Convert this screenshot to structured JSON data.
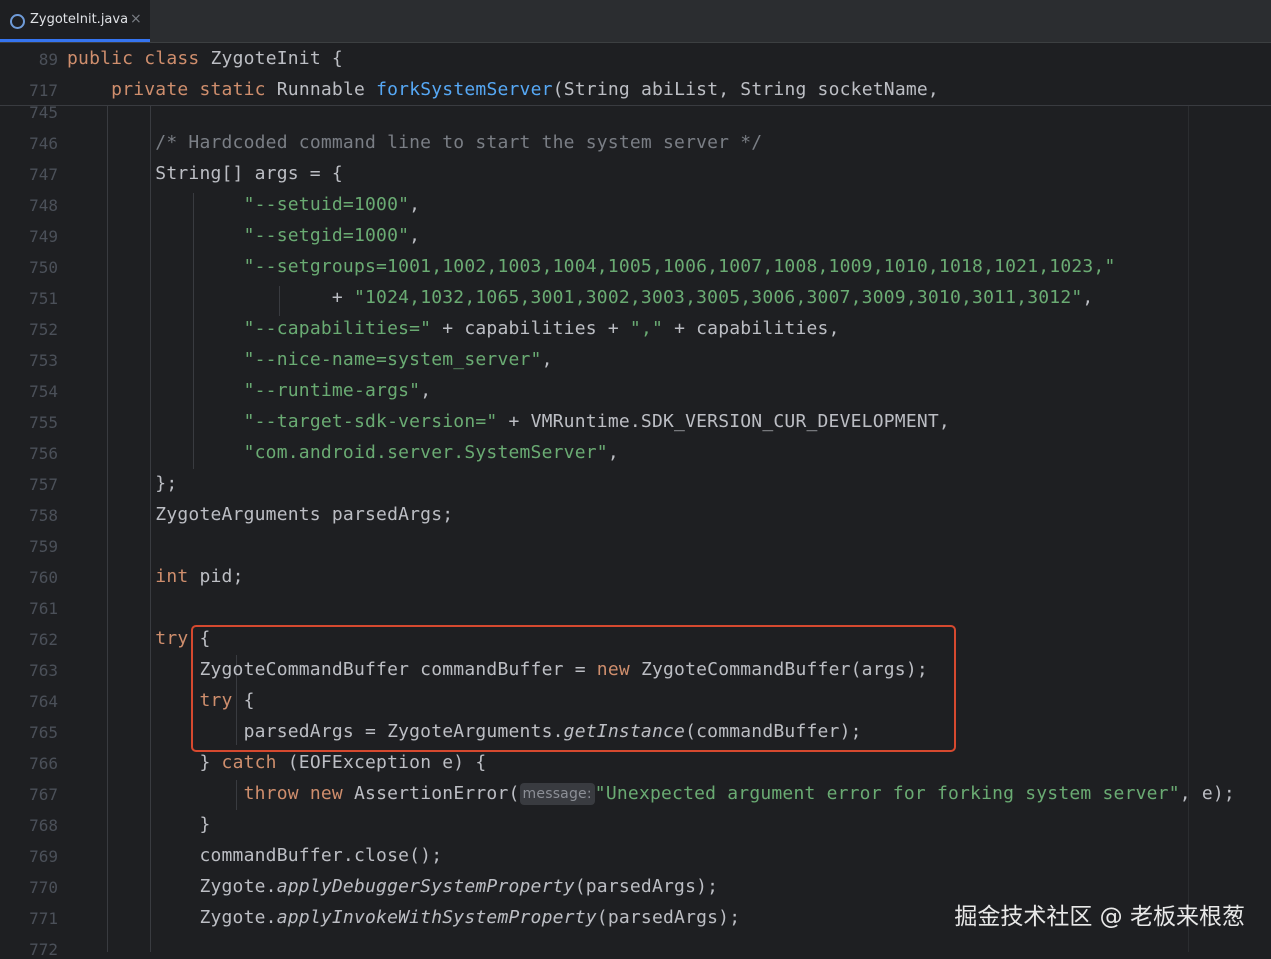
{
  "tab": {
    "icon": "java-class-icon",
    "label": "ZygoteInit.java",
    "close": "×"
  },
  "sticky": [
    {
      "num": "89",
      "tokens": [
        [
          "kw",
          "public"
        ],
        [
          "p",
          " "
        ],
        [
          "kw",
          "class"
        ],
        [
          "p",
          " ZygoteInit {"
        ]
      ]
    },
    {
      "num": "717",
      "tokens": [
        [
          "p",
          "    "
        ],
        [
          "kw",
          "private"
        ],
        [
          "p",
          " "
        ],
        [
          "kw",
          "static"
        ],
        [
          "p",
          " Runnable "
        ],
        [
          "fn",
          "forkSystemServer"
        ],
        [
          "p",
          "(String abiList, String socketName,"
        ]
      ]
    }
  ],
  "lines": [
    {
      "num": "745",
      "tokens": []
    },
    {
      "num": "746",
      "tokens": [
        [
          "p",
          "        "
        ],
        [
          "cmt",
          "/* Hardcoded command line to start the system server */"
        ]
      ]
    },
    {
      "num": "747",
      "tokens": [
        [
          "p",
          "        String[] args = {"
        ]
      ]
    },
    {
      "num": "748",
      "tokens": [
        [
          "p",
          "                "
        ],
        [
          "str",
          "\"--setuid=1000\""
        ],
        [
          "p",
          ","
        ]
      ]
    },
    {
      "num": "749",
      "tokens": [
        [
          "p",
          "                "
        ],
        [
          "str",
          "\"--setgid=1000\""
        ],
        [
          "p",
          ","
        ]
      ]
    },
    {
      "num": "750",
      "tokens": [
        [
          "p",
          "                "
        ],
        [
          "str",
          "\"--setgroups=1001,1002,1003,1004,1005,1006,1007,1008,1009,1010,1018,1021,1023,\""
        ]
      ]
    },
    {
      "num": "751",
      "tokens": [
        [
          "p",
          "                        + "
        ],
        [
          "str",
          "\"1024,1032,1065,3001,3002,3003,3005,3006,3007,3009,3010,3011,3012\""
        ],
        [
          "p",
          ","
        ]
      ]
    },
    {
      "num": "752",
      "tokens": [
        [
          "p",
          "                "
        ],
        [
          "str",
          "\"--capabilities=\""
        ],
        [
          "p",
          " + capabilities + "
        ],
        [
          "str",
          "\",\""
        ],
        [
          "p",
          " + capabilities,"
        ]
      ]
    },
    {
      "num": "753",
      "tokens": [
        [
          "p",
          "                "
        ],
        [
          "str",
          "\"--nice-name=system_server\""
        ],
        [
          "p",
          ","
        ]
      ]
    },
    {
      "num": "754",
      "tokens": [
        [
          "p",
          "                "
        ],
        [
          "str",
          "\"--runtime-args\""
        ],
        [
          "p",
          ","
        ]
      ]
    },
    {
      "num": "755",
      "tokens": [
        [
          "p",
          "                "
        ],
        [
          "str",
          "\"--target-sdk-version=\""
        ],
        [
          "p",
          " + VMRuntime.SDK_VERSION_CUR_DEVELOPMENT,"
        ]
      ]
    },
    {
      "num": "756",
      "tokens": [
        [
          "p",
          "                "
        ],
        [
          "str",
          "\"com.android.server.SystemServer\""
        ],
        [
          "p",
          ","
        ]
      ]
    },
    {
      "num": "757",
      "tokens": [
        [
          "p",
          "        };"
        ]
      ]
    },
    {
      "num": "758",
      "tokens": [
        [
          "p",
          "        ZygoteArguments parsedArgs;"
        ]
      ]
    },
    {
      "num": "759",
      "tokens": []
    },
    {
      "num": "760",
      "tokens": [
        [
          "p",
          "        "
        ],
        [
          "kw",
          "int"
        ],
        [
          "p",
          " pid;"
        ]
      ]
    },
    {
      "num": "761",
      "tokens": []
    },
    {
      "num": "762",
      "tokens": [
        [
          "p",
          "        "
        ],
        [
          "kw",
          "try"
        ],
        [
          "p",
          " {"
        ]
      ]
    },
    {
      "num": "763",
      "tokens": [
        [
          "p",
          "            ZygoteCommandBuffer commandBuffer = "
        ],
        [
          "kw",
          "new"
        ],
        [
          "p",
          " ZygoteCommandBuffer(args);"
        ]
      ]
    },
    {
      "num": "764",
      "tokens": [
        [
          "p",
          "            "
        ],
        [
          "kw",
          "try"
        ],
        [
          "p",
          " {"
        ]
      ]
    },
    {
      "num": "765",
      "tokens": [
        [
          "p",
          "                parsedArgs = ZygoteArguments."
        ],
        [
          "it",
          "getInstance"
        ],
        [
          "p",
          "(commandBuffer);"
        ]
      ]
    },
    {
      "num": "766",
      "tokens": [
        [
          "p",
          "            } "
        ],
        [
          "kw",
          "catch"
        ],
        [
          "p",
          " (EOFException e) {"
        ]
      ]
    },
    {
      "num": "767",
      "tokens": [
        [
          "p",
          "                "
        ],
        [
          "kw",
          "throw"
        ],
        [
          "p",
          " "
        ],
        [
          "kw",
          "new"
        ],
        [
          "p",
          " AssertionError("
        ],
        [
          "hint",
          "message:"
        ],
        [
          "str",
          "\"Unexpected argument error for forking system server\""
        ],
        [
          "p",
          ", e);"
        ]
      ]
    },
    {
      "num": "768",
      "tokens": [
        [
          "p",
          "            }"
        ]
      ]
    },
    {
      "num": "769",
      "tokens": [
        [
          "p",
          "            commandBuffer.close();"
        ]
      ]
    },
    {
      "num": "770",
      "tokens": [
        [
          "p",
          "            Zygote."
        ],
        [
          "it",
          "applyDebuggerSystemProperty"
        ],
        [
          "p",
          "(parsedArgs);"
        ]
      ]
    },
    {
      "num": "771",
      "tokens": [
        [
          "p",
          "            Zygote."
        ],
        [
          "it",
          "applyInvokeWithSystemProperty"
        ],
        [
          "p",
          "(parsedArgs);"
        ]
      ]
    },
    {
      "num": "772",
      "tokens": []
    }
  ],
  "watermark": "掘金技术社区 @ 老板来根葱",
  "colors": {
    "keyword": "#cf8e6d",
    "function": "#56a8f5",
    "string": "#6aab73",
    "comment": "#7a7e85",
    "highlight_box": "#d6492f"
  }
}
